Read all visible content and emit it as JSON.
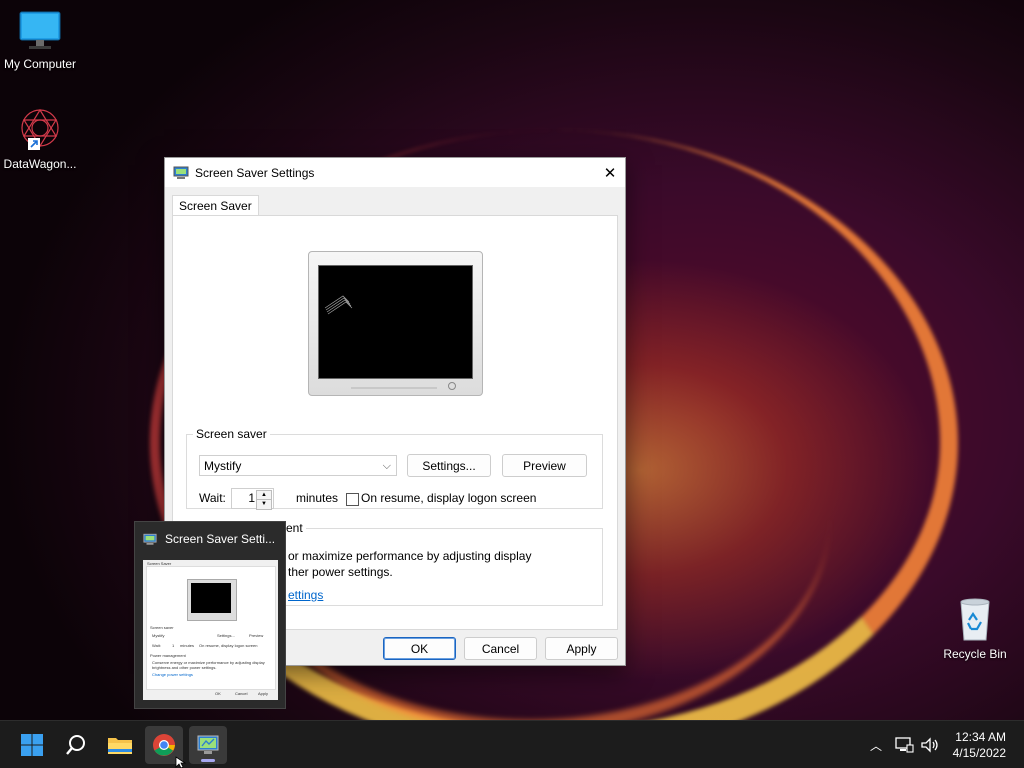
{
  "desktop": {
    "icons": [
      {
        "label": "My Computer"
      },
      {
        "label": "DataWagon..."
      },
      {
        "label": "Recycle Bin"
      }
    ]
  },
  "dialog": {
    "title": "Screen Saver Settings",
    "tab_label": "Screen Saver",
    "screensaver_group_label": "Screen saver",
    "screensaver_selected": "Mystify",
    "settings_button": "Settings...",
    "preview_button": "Preview",
    "wait_label": "Wait:",
    "wait_value": "1",
    "minutes_label": "minutes",
    "resume_checkbox_label": "On resume, display logon screen",
    "power_group_label_visible": "ent",
    "power_text_line1": "or maximize performance by adjusting display",
    "power_text_line2": "ther power settings.",
    "power_link_visible": "ettings",
    "ok_button": "OK",
    "cancel_button": "Cancel",
    "apply_button": "Apply"
  },
  "taskbar_preview": {
    "title": "Screen Saver Setti...",
    "mini_tab": "Screen Saver",
    "mini_group": "Screen saver",
    "mini_select": "Mystify",
    "mini_settings": "Settings...",
    "mini_preview": "Preview",
    "mini_wait": "Wait:",
    "mini_wait_value": "1",
    "mini_minutes": "minutes",
    "mini_resume": "On resume, display logon screen",
    "mini_power_group": "Power management",
    "mini_power_text1": "Conserve energy or maximize performance by adjusting display",
    "mini_power_text2": "brightness and other power settings.",
    "mini_power_link": "Change power settings",
    "mini_ok": "OK",
    "mini_cancel": "Cancel",
    "mini_apply": "Apply"
  },
  "taskbar": {
    "items": [
      "start-icon",
      "search-icon",
      "file-explorer-icon",
      "chrome-icon",
      "screen-saver-settings-icon"
    ],
    "clock_time": "12:34 AM",
    "clock_date": "4/15/2022"
  },
  "colors": {
    "accent": "#1b65c1",
    "link": "#0066cc",
    "taskbar": "#1c1c1c"
  }
}
